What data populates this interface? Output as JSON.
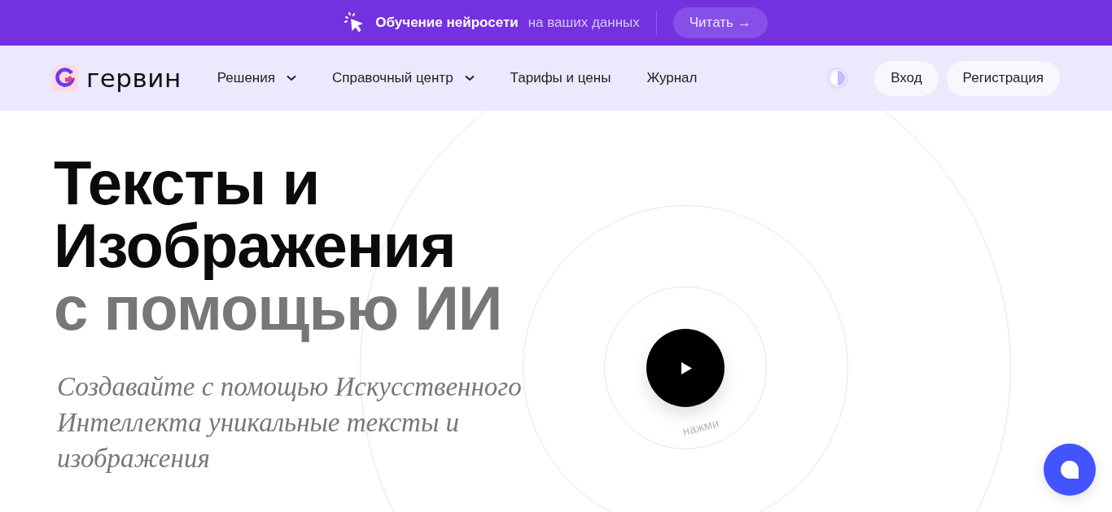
{
  "banner": {
    "title": "Обучение нейросети",
    "subtitle": "на ваших данных",
    "button": "Читать",
    "button_arrow": "→"
  },
  "nav": {
    "logo": "гервин",
    "items": [
      {
        "label": "Решения",
        "dropdown": true
      },
      {
        "label": "Справочный центр",
        "dropdown": true
      },
      {
        "label": "Тарифы и цены",
        "dropdown": false
      },
      {
        "label": "Журнал",
        "dropdown": false
      }
    ],
    "login": "Вход",
    "register": "Регистрация"
  },
  "hero": {
    "title_lines": [
      "Тексты и",
      "Изображения"
    ],
    "accent": "с помощью ИИ",
    "subtitle": "Создавайте с помощью Искусственного Интеллекта уникальные тексты и изображения"
  },
  "player": {
    "caption": "нажми"
  }
}
